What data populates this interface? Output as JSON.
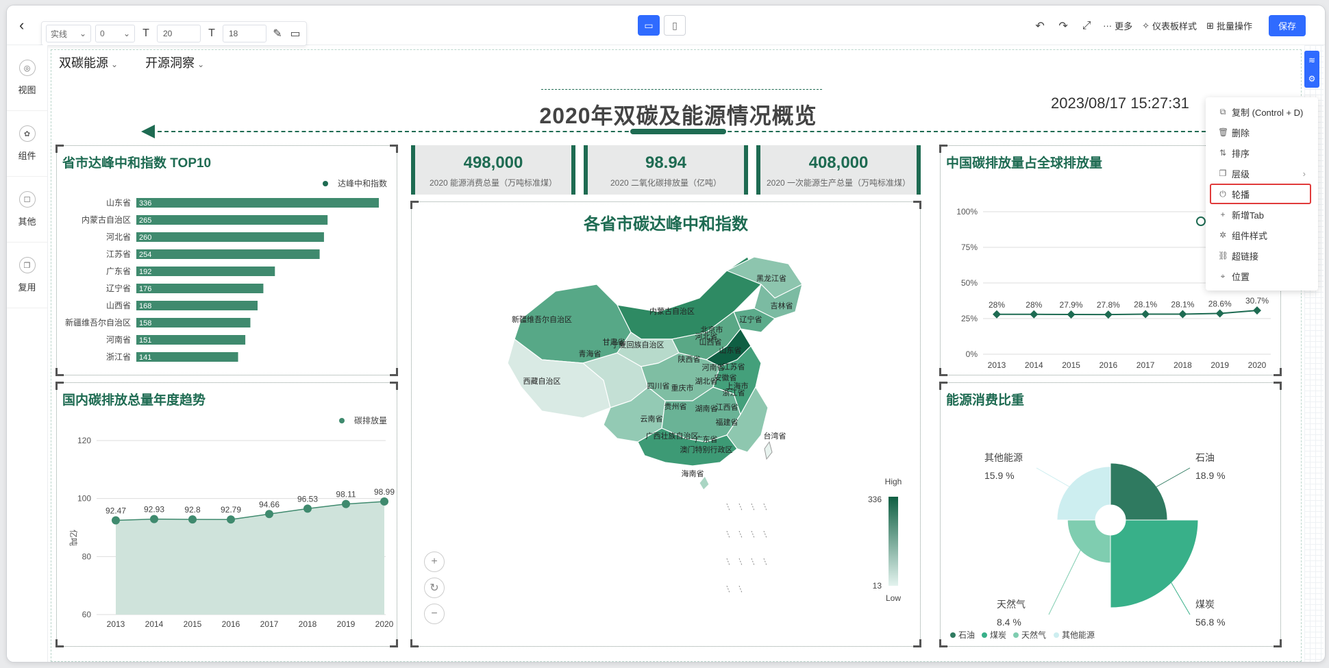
{
  "topbar": {
    "format": {
      "line_style": "实线",
      "line_width": "0",
      "font_size": "20",
      "font_size2": "18"
    },
    "tools": {
      "more": "更多",
      "dashboard_style": "仪表板样式",
      "batch": "批量操作",
      "save": "保存"
    }
  },
  "sidebar": {
    "items": [
      {
        "label": "视图",
        "icon": "view-icon"
      },
      {
        "label": "组件",
        "icon": "component-icon"
      },
      {
        "label": "其他",
        "icon": "other-icon"
      },
      {
        "label": "复用",
        "icon": "reuse-icon"
      }
    ]
  },
  "tabs": [
    {
      "label": "双碳能源"
    },
    {
      "label": "开源洞察"
    }
  ],
  "dashboard": {
    "title": "2020年双碳及能源情况概览",
    "datetime": "2023/08/17 15:27:31"
  },
  "kpis": [
    {
      "value": "498,000",
      "label": "2020 能源消费总量（万吨标准煤）"
    },
    {
      "value": "98.94",
      "label": "2020 二氧化碳排放量（亿吨）"
    },
    {
      "value": "408,000",
      "label": "2020 一次能源生产总量（万吨标准煤）"
    }
  ],
  "panels": {
    "top10_title": "省市达峰中和指数 TOP10",
    "top10_legend": "达峰中和指数",
    "trend_title": "国内碳排放总量年度趋势",
    "trend_legend": "碳排放量",
    "map_title": "各省市碳达峰中和指数",
    "share_title": "中国碳排放量占全球排放量",
    "energy_title": "能源消费比重"
  },
  "map": {
    "legend_high": "High",
    "legend_low": "Low",
    "legend_max": "336",
    "legend_min": "13",
    "labels": [
      "新疆维吾尔自治区",
      "西藏自治区",
      "青海省",
      "甘肃省",
      "内蒙古自治区",
      "黑龙江省",
      "吉林省",
      "辽宁省",
      "北京市",
      "山西省",
      "陕西省",
      "四川省",
      "云南省",
      "重庆市",
      "贵州省",
      "湖北省",
      "湖南省",
      "江西省",
      "河南省",
      "山东省",
      "安徽省",
      "江苏省",
      "上海市",
      "浙江省",
      "福建省",
      "广东省",
      "台湾省",
      "海南省",
      "宁夏回族自治区",
      "河北省",
      "广西壮族自治区",
      "澳门特别行政区"
    ]
  },
  "context_menu": {
    "items": [
      {
        "label": "复制 (Control + D)",
        "icon": "copy-icon"
      },
      {
        "label": "删除",
        "icon": "trash-icon"
      },
      {
        "label": "排序",
        "icon": "sort-icon"
      },
      {
        "label": "层级",
        "icon": "layer-icon",
        "submenu": true
      },
      {
        "label": "轮播",
        "icon": "power-icon",
        "highlighted": true
      },
      {
        "label": "新增Tab",
        "icon": "plus-icon"
      },
      {
        "label": "组件样式",
        "icon": "style-icon"
      },
      {
        "label": "超链接",
        "icon": "link-icon"
      },
      {
        "label": "位置",
        "icon": "location-icon"
      }
    ]
  },
  "chart_data": [
    {
      "type": "bar",
      "title": "省市达峰中和指数 TOP10",
      "orientation": "horizontal",
      "categories": [
        "山东省",
        "内蒙古自治区",
        "河北省",
        "江苏省",
        "广东省",
        "辽宁省",
        "山西省",
        "新疆维吾尔自治区",
        "河南省",
        "浙江省"
      ],
      "series": [
        {
          "name": "达峰中和指数",
          "values": [
            336,
            265,
            260,
            254,
            192,
            176,
            168,
            158,
            151,
            141
          ]
        }
      ],
      "color": "#3f8a6e"
    },
    {
      "type": "area",
      "title": "国内碳排放总量年度趋势",
      "x": [
        "2013",
        "2014",
        "2015",
        "2016",
        "2017",
        "2018",
        "2019",
        "2020"
      ],
      "series": [
        {
          "name": "碳排放量",
          "values": [
            92.47,
            92.93,
            92.8,
            92.79,
            94.66,
            96.53,
            98.11,
            98.99
          ]
        }
      ],
      "ylabel": "亿吨",
      "ylim": [
        60,
        120
      ],
      "yticks": [
        60,
        80,
        100,
        120
      ],
      "color": "#3f8a6e"
    },
    {
      "type": "line",
      "title": "中国碳排放量占全球排放量",
      "x": [
        "2013",
        "2014",
        "2015",
        "2016",
        "2017",
        "2018",
        "2019",
        "2020"
      ],
      "values": [
        28,
        28,
        27.9,
        27.8,
        28.1,
        28.1,
        28.6,
        30.7
      ],
      "value_labels": [
        "28%",
        "28%",
        "27.9%",
        "27.8%",
        "28.1%",
        "28.1%",
        "28.6%",
        "30.7%"
      ],
      "ylim": [
        0,
        100
      ],
      "yticks": [
        "0%",
        "25%",
        "50%",
        "75%",
        "100%"
      ],
      "color": "#1e6b52"
    },
    {
      "type": "pie",
      "title": "能源消费比重",
      "style": "rose",
      "slices": [
        {
          "name": "石油",
          "value": 18.9,
          "label": "18.9 %",
          "color": "#2f7a60"
        },
        {
          "name": "煤炭",
          "value": 56.8,
          "label": "56.8 %",
          "color": "#38b089"
        },
        {
          "name": "天然气",
          "value": 8.4,
          "label": "8.4 %",
          "color": "#7fcdb0"
        },
        {
          "name": "其他能源",
          "value": 15.9,
          "label": "15.9 %",
          "color": "#cdeef0"
        }
      ]
    }
  ]
}
